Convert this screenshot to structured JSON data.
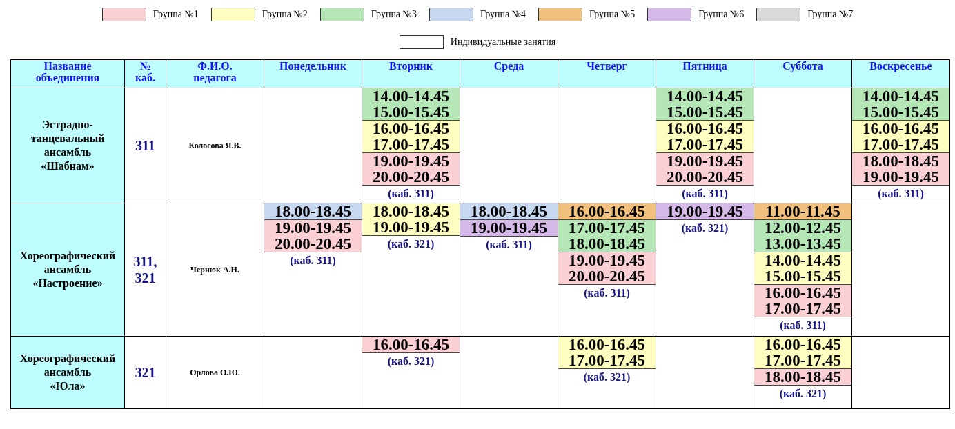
{
  "legend": [
    {
      "label": "Группа №1",
      "color": "#fbd0d5"
    },
    {
      "label": "Группа №2",
      "color": "#fdfdbf"
    },
    {
      "label": "Группа №3",
      "color": "#b5e7b6"
    },
    {
      "label": "Группа №4",
      "color": "#c7d9f0"
    },
    {
      "label": "Группа №5",
      "color": "#f2c17e"
    },
    {
      "label": "Группа №6",
      "color": "#d5b9e9"
    },
    {
      "label": "Группа №7",
      "color": "#d9d9d9"
    },
    {
      "label": "Индивидуальные занятия",
      "color": "#ffffff"
    }
  ],
  "table": {
    "columns": [
      "Название объединения",
      "№ каб.",
      "Ф.И.О. педагога",
      "Понедельник",
      "Вторник",
      "Среда",
      "Четверг",
      "Пятница",
      "Суббота",
      "Воскресенье"
    ],
    "rows": [
      {
        "name": "Эстрадно-\nтанцевальный\nансамбль\n«Шабнам»",
        "room": "311",
        "teacher": "Колосова Я.В.",
        "days": {
          "tuesday": {
            "blocks": [
              {
                "color": "#b5e7b6",
                "times": [
                  "14.00-14.45",
                  "15.00-15.45"
                ]
              },
              {
                "color": "#fdfdbf",
                "times": [
                  "16.00-16.45",
                  "17.00-17.45"
                ]
              },
              {
                "color": "#fbd0d5",
                "times": [
                  "19.00-19.45",
                  "20.00-20.45"
                ]
              }
            ],
            "note": "(каб. 311)"
          },
          "friday": {
            "blocks": [
              {
                "color": "#b5e7b6",
                "times": [
                  "14.00-14.45",
                  "15.00-15.45"
                ]
              },
              {
                "color": "#fdfdbf",
                "times": [
                  "16.00-16.45",
                  "17.00-17.45"
                ]
              },
              {
                "color": "#fbd0d5",
                "times": [
                  "19.00-19.45",
                  "20.00-20.45"
                ]
              }
            ],
            "note": "(каб. 311)"
          },
          "sunday": {
            "blocks": [
              {
                "color": "#b5e7b6",
                "times": [
                  "14.00-14.45",
                  "15.00-15.45"
                ]
              },
              {
                "color": "#fdfdbf",
                "times": [
                  "16.00-16.45",
                  "17.00-17.45"
                ]
              },
              {
                "color": "#fbd0d5",
                "times": [
                  "18.00-18.45",
                  "19.00-19.45"
                ]
              }
            ],
            "note": "(каб. 311)"
          }
        }
      },
      {
        "name": "Хореографический\nансамбль\n«Настроение»",
        "room": "311, 321",
        "teacher": "Чернюк  А.Н.",
        "days": {
          "monday": {
            "blocks": [
              {
                "color": "#c7d9f0",
                "times": [
                  "18.00-18.45"
                ]
              },
              {
                "color": "#fbd0d5",
                "times": [
                  "19.00-19.45",
                  "20.00-20.45"
                ]
              }
            ],
            "note": "(каб. 311)"
          },
          "tuesday": {
            "blocks": [
              {
                "color": "#fdfdbf",
                "times": [
                  "18.00-18.45",
                  "19.00-19.45"
                ]
              }
            ],
            "note": "(каб. 321)"
          },
          "wednesday": {
            "blocks": [
              {
                "color": "#c7d9f0",
                "times": [
                  "18.00-18.45"
                ]
              },
              {
                "color": "#d5b9e9",
                "times": [
                  "19.00-19.45"
                ]
              }
            ],
            "note": "(каб. 311)"
          },
          "thursday": {
            "blocks": [
              {
                "color": "#f2c17e",
                "times": [
                  "16.00-16.45"
                ]
              },
              {
                "color": "#b5e7b6",
                "times": [
                  "17.00-17.45",
                  "18.00-18.45"
                ]
              },
              {
                "color": "#fbd0d5",
                "times": [
                  "19.00-19.45",
                  "20.00-20.45"
                ]
              }
            ],
            "note": "(каб. 311)"
          },
          "friday": {
            "blocks": [
              {
                "color": "#d5b9e9",
                "times": [
                  "19.00-19.45"
                ]
              }
            ],
            "note": "(каб. 321)"
          },
          "saturday": {
            "blocks": [
              {
                "color": "#f2c17e",
                "times": [
                  "11.00-11.45"
                ]
              },
              {
                "color": "#b5e7b6",
                "times": [
                  "12.00-12.45",
                  "13.00-13.45"
                ]
              },
              {
                "color": "#fdfdbf",
                "times": [
                  "14.00-14.45",
                  "15.00-15.45"
                ]
              },
              {
                "color": "#fbd0d5",
                "times": [
                  "16.00-16.45",
                  "17.00-17.45"
                ]
              }
            ],
            "note": "(каб. 311)"
          }
        }
      },
      {
        "name": "Хореографический\nансамбль\n«Юла»",
        "room": "321",
        "teacher": "Орлова О.Ю.",
        "days": {
          "tuesday": {
            "blocks": [
              {
                "color": "#fbd0d5",
                "times": [
                  "16.00-16.45"
                ]
              }
            ],
            "note": "(каб. 321)"
          },
          "thursday": {
            "blocks": [
              {
                "color": "#fdfdbf",
                "times": [
                  "16.00-16.45",
                  "17.00-17.45"
                ]
              }
            ],
            "note": "(каб. 321)"
          },
          "saturday": {
            "blocks": [
              {
                "color": "#fdfdbf",
                "times": [
                  "16.00-16.45",
                  "17.00-17.45"
                ]
              },
              {
                "color": "#fbd0d5",
                "times": [
                  "18.00-18.45"
                ]
              }
            ],
            "note": "(каб. 321)"
          }
        }
      }
    ]
  }
}
